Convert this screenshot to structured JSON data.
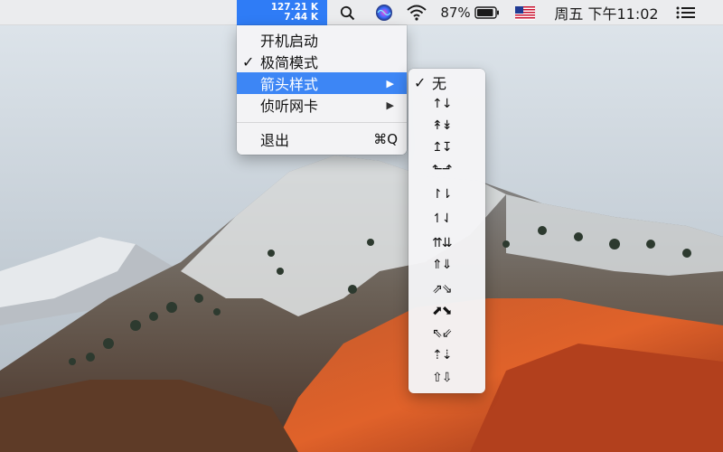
{
  "menubar": {
    "net_speed": {
      "up": "127.21 K",
      "down": "7.44 K"
    },
    "battery_percent": "87%",
    "clock": "周五 下午11:02",
    "icons": [
      "search-icon",
      "siri-icon",
      "wifi-icon",
      "battery-icon",
      "us-flag-icon",
      "list-icon"
    ]
  },
  "dropdown": {
    "items": [
      {
        "label": "开机启动",
        "checked": false
      },
      {
        "label": "极简模式",
        "checked": true,
        "check": "✓"
      },
      {
        "label": "箭头样式",
        "highlighted": true,
        "submenu_arrow": "▶"
      },
      {
        "label": "侦听网卡",
        "submenu_arrow": "▶"
      }
    ],
    "quit": {
      "label": "退出",
      "shortcut": "⌘Q"
    }
  },
  "submenu": {
    "check": "✓",
    "items": [
      "无",
      "↑↓",
      "↟↡",
      "↥↧",
      "⬑⬏",
      "↾⇂",
      "↿⇃",
      "⇈⇊",
      "⇑⇓",
      "⇗⇘",
      "⬈⬊",
      "⇖⇙",
      "⇡⇣",
      "⇧⇩"
    ]
  },
  "colors": {
    "highlight": "#3d86f5",
    "net_speed_bg": "#2f7cf6",
    "menubar_bg": "#ececee"
  }
}
